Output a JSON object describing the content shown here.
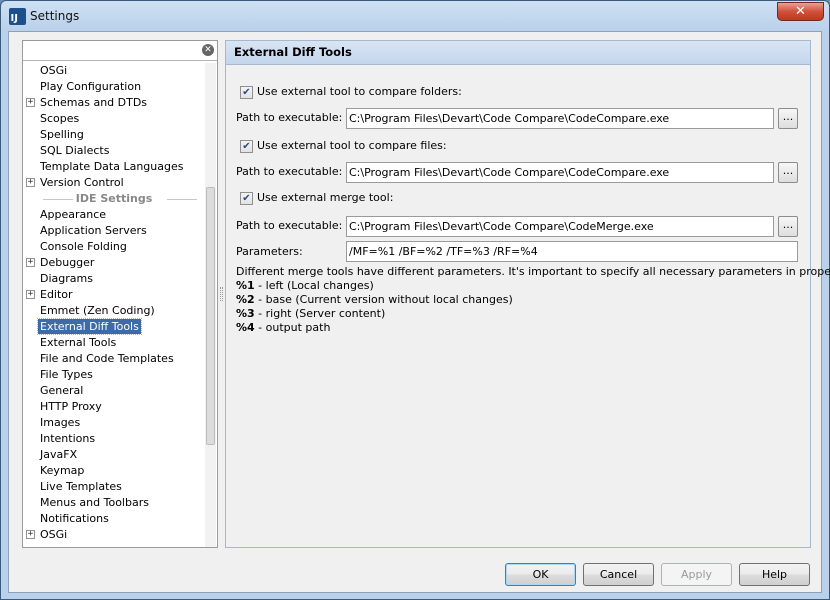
{
  "window": {
    "title": "Settings",
    "close_label": "✕"
  },
  "search": {
    "value": "",
    "placeholder": ""
  },
  "tree": {
    "items_before": [
      {
        "label": "OSGi",
        "expandable": false
      },
      {
        "label": "Play Configuration",
        "expandable": false
      },
      {
        "label": "Schemas and DTDs",
        "expandable": true
      },
      {
        "label": "Scopes",
        "expandable": false
      },
      {
        "label": "Spelling",
        "expandable": false
      },
      {
        "label": "SQL Dialects",
        "expandable": false
      },
      {
        "label": "Template Data Languages",
        "expandable": false
      },
      {
        "label": "Version Control",
        "expandable": true
      }
    ],
    "group_header": "IDE Settings",
    "items_after": [
      {
        "label": "Appearance",
        "expandable": false
      },
      {
        "label": "Application Servers",
        "expandable": false
      },
      {
        "label": "Console Folding",
        "expandable": false
      },
      {
        "label": "Debugger",
        "expandable": true
      },
      {
        "label": "Diagrams",
        "expandable": false
      },
      {
        "label": "Editor",
        "expandable": true
      },
      {
        "label": "Emmet (Zen Coding)",
        "expandable": false
      },
      {
        "label": "External Diff Tools",
        "expandable": false,
        "selected": true
      },
      {
        "label": "External Tools",
        "expandable": false
      },
      {
        "label": "File and Code Templates",
        "expandable": false
      },
      {
        "label": "File Types",
        "expandable": false
      },
      {
        "label": "General",
        "expandable": false
      },
      {
        "label": "HTTP Proxy",
        "expandable": false
      },
      {
        "label": "Images",
        "expandable": false
      },
      {
        "label": "Intentions",
        "expandable": false
      },
      {
        "label": "JavaFX",
        "expandable": false
      },
      {
        "label": "Keymap",
        "expandable": false
      },
      {
        "label": "Live Templates",
        "expandable": false
      },
      {
        "label": "Menus and Toolbars",
        "expandable": false
      },
      {
        "label": "Notifications",
        "expandable": false
      },
      {
        "label": "OSGi",
        "expandable": true
      }
    ]
  },
  "panel": {
    "title": "External Diff Tools",
    "folders": {
      "checkbox_label": "Use external tool to compare folders:",
      "checked": true,
      "path_label": "Path to executable:",
      "path_value": "C:\\Program Files\\Devart\\Code Compare\\CodeCompare.exe"
    },
    "files": {
      "checkbox_label": "Use external tool to compare files:",
      "checked": true,
      "path_label": "Path to executable:",
      "path_value": "C:\\Program Files\\Devart\\Code Compare\\CodeCompare.exe"
    },
    "merge": {
      "checkbox_label": "Use external merge tool:",
      "checked": true,
      "path_label": "Path to executable:",
      "path_value": "C:\\Program Files\\Devart\\Code Compare\\CodeMerge.exe",
      "params_label": "Parameters:",
      "params_value": "/MF=%1 /BF=%2 /TF=%3 /RF=%4"
    },
    "browse_label": "...",
    "help": {
      "intro": "Different merge tools have different parameters. It's important to specify all necessary parameters in proper order",
      "params": [
        {
          "key": "%1",
          "desc": " - left (Local changes)"
        },
        {
          "key": "%2",
          "desc": " - base (Current version without local changes)"
        },
        {
          "key": "%3",
          "desc": " - right (Server content)"
        },
        {
          "key": "%4",
          "desc": " - output path"
        }
      ]
    }
  },
  "buttons": {
    "ok": "OK",
    "cancel": "Cancel",
    "apply": "Apply",
    "help": "Help"
  }
}
